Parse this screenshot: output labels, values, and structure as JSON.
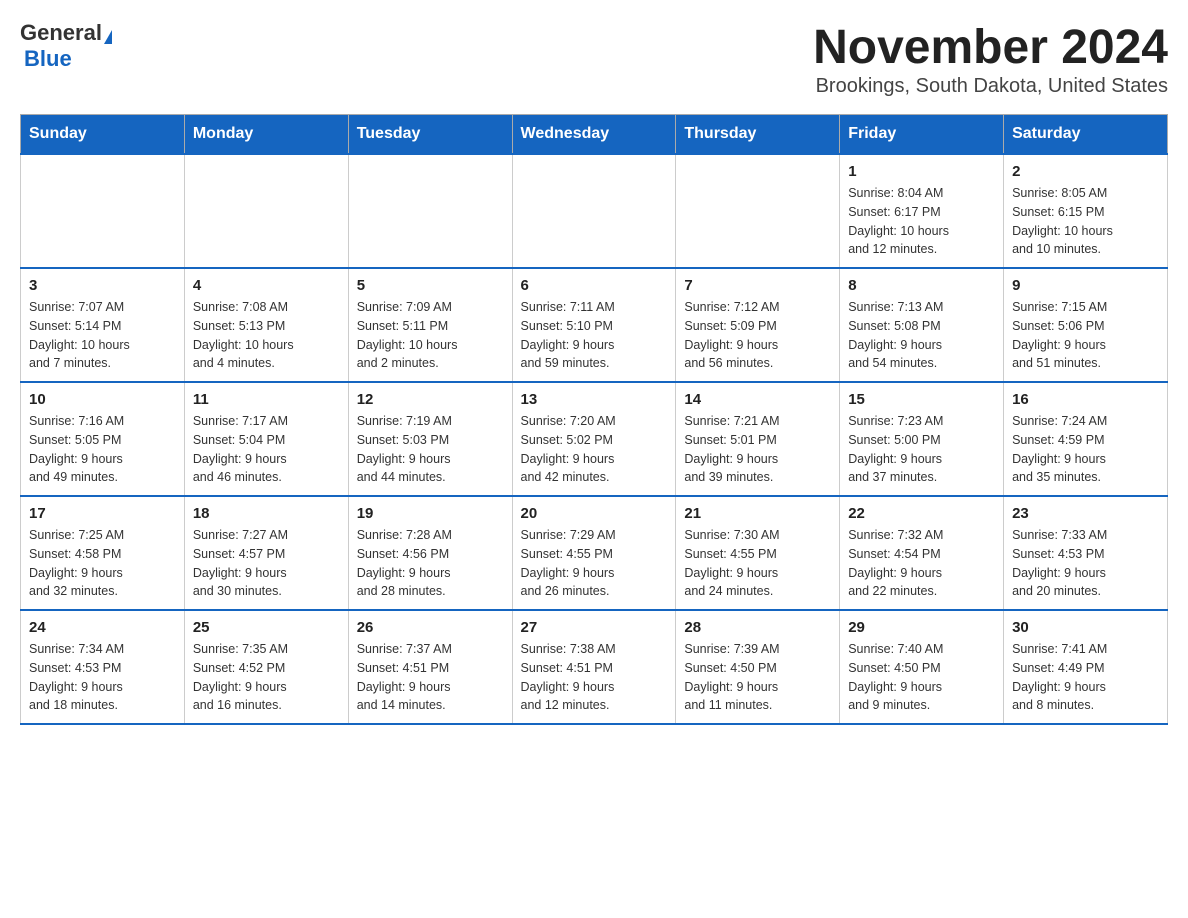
{
  "logo": {
    "general": "General",
    "blue": "Blue"
  },
  "title": "November 2024",
  "subtitle": "Brookings, South Dakota, United States",
  "days_of_week": [
    "Sunday",
    "Monday",
    "Tuesday",
    "Wednesday",
    "Thursday",
    "Friday",
    "Saturday"
  ],
  "weeks": [
    [
      {
        "day": "",
        "info": ""
      },
      {
        "day": "",
        "info": ""
      },
      {
        "day": "",
        "info": ""
      },
      {
        "day": "",
        "info": ""
      },
      {
        "day": "",
        "info": ""
      },
      {
        "day": "1",
        "info": "Sunrise: 8:04 AM\nSunset: 6:17 PM\nDaylight: 10 hours\nand 12 minutes."
      },
      {
        "day": "2",
        "info": "Sunrise: 8:05 AM\nSunset: 6:15 PM\nDaylight: 10 hours\nand 10 minutes."
      }
    ],
    [
      {
        "day": "3",
        "info": "Sunrise: 7:07 AM\nSunset: 5:14 PM\nDaylight: 10 hours\nand 7 minutes."
      },
      {
        "day": "4",
        "info": "Sunrise: 7:08 AM\nSunset: 5:13 PM\nDaylight: 10 hours\nand 4 minutes."
      },
      {
        "day": "5",
        "info": "Sunrise: 7:09 AM\nSunset: 5:11 PM\nDaylight: 10 hours\nand 2 minutes."
      },
      {
        "day": "6",
        "info": "Sunrise: 7:11 AM\nSunset: 5:10 PM\nDaylight: 9 hours\nand 59 minutes."
      },
      {
        "day": "7",
        "info": "Sunrise: 7:12 AM\nSunset: 5:09 PM\nDaylight: 9 hours\nand 56 minutes."
      },
      {
        "day": "8",
        "info": "Sunrise: 7:13 AM\nSunset: 5:08 PM\nDaylight: 9 hours\nand 54 minutes."
      },
      {
        "day": "9",
        "info": "Sunrise: 7:15 AM\nSunset: 5:06 PM\nDaylight: 9 hours\nand 51 minutes."
      }
    ],
    [
      {
        "day": "10",
        "info": "Sunrise: 7:16 AM\nSunset: 5:05 PM\nDaylight: 9 hours\nand 49 minutes."
      },
      {
        "day": "11",
        "info": "Sunrise: 7:17 AM\nSunset: 5:04 PM\nDaylight: 9 hours\nand 46 minutes."
      },
      {
        "day": "12",
        "info": "Sunrise: 7:19 AM\nSunset: 5:03 PM\nDaylight: 9 hours\nand 44 minutes."
      },
      {
        "day": "13",
        "info": "Sunrise: 7:20 AM\nSunset: 5:02 PM\nDaylight: 9 hours\nand 42 minutes."
      },
      {
        "day": "14",
        "info": "Sunrise: 7:21 AM\nSunset: 5:01 PM\nDaylight: 9 hours\nand 39 minutes."
      },
      {
        "day": "15",
        "info": "Sunrise: 7:23 AM\nSunset: 5:00 PM\nDaylight: 9 hours\nand 37 minutes."
      },
      {
        "day": "16",
        "info": "Sunrise: 7:24 AM\nSunset: 4:59 PM\nDaylight: 9 hours\nand 35 minutes."
      }
    ],
    [
      {
        "day": "17",
        "info": "Sunrise: 7:25 AM\nSunset: 4:58 PM\nDaylight: 9 hours\nand 32 minutes."
      },
      {
        "day": "18",
        "info": "Sunrise: 7:27 AM\nSunset: 4:57 PM\nDaylight: 9 hours\nand 30 minutes."
      },
      {
        "day": "19",
        "info": "Sunrise: 7:28 AM\nSunset: 4:56 PM\nDaylight: 9 hours\nand 28 minutes."
      },
      {
        "day": "20",
        "info": "Sunrise: 7:29 AM\nSunset: 4:55 PM\nDaylight: 9 hours\nand 26 minutes."
      },
      {
        "day": "21",
        "info": "Sunrise: 7:30 AM\nSunset: 4:55 PM\nDaylight: 9 hours\nand 24 minutes."
      },
      {
        "day": "22",
        "info": "Sunrise: 7:32 AM\nSunset: 4:54 PM\nDaylight: 9 hours\nand 22 minutes."
      },
      {
        "day": "23",
        "info": "Sunrise: 7:33 AM\nSunset: 4:53 PM\nDaylight: 9 hours\nand 20 minutes."
      }
    ],
    [
      {
        "day": "24",
        "info": "Sunrise: 7:34 AM\nSunset: 4:53 PM\nDaylight: 9 hours\nand 18 minutes."
      },
      {
        "day": "25",
        "info": "Sunrise: 7:35 AM\nSunset: 4:52 PM\nDaylight: 9 hours\nand 16 minutes."
      },
      {
        "day": "26",
        "info": "Sunrise: 7:37 AM\nSunset: 4:51 PM\nDaylight: 9 hours\nand 14 minutes."
      },
      {
        "day": "27",
        "info": "Sunrise: 7:38 AM\nSunset: 4:51 PM\nDaylight: 9 hours\nand 12 minutes."
      },
      {
        "day": "28",
        "info": "Sunrise: 7:39 AM\nSunset: 4:50 PM\nDaylight: 9 hours\nand 11 minutes."
      },
      {
        "day": "29",
        "info": "Sunrise: 7:40 AM\nSunset: 4:50 PM\nDaylight: 9 hours\nand 9 minutes."
      },
      {
        "day": "30",
        "info": "Sunrise: 7:41 AM\nSunset: 4:49 PM\nDaylight: 9 hours\nand 8 minutes."
      }
    ]
  ]
}
